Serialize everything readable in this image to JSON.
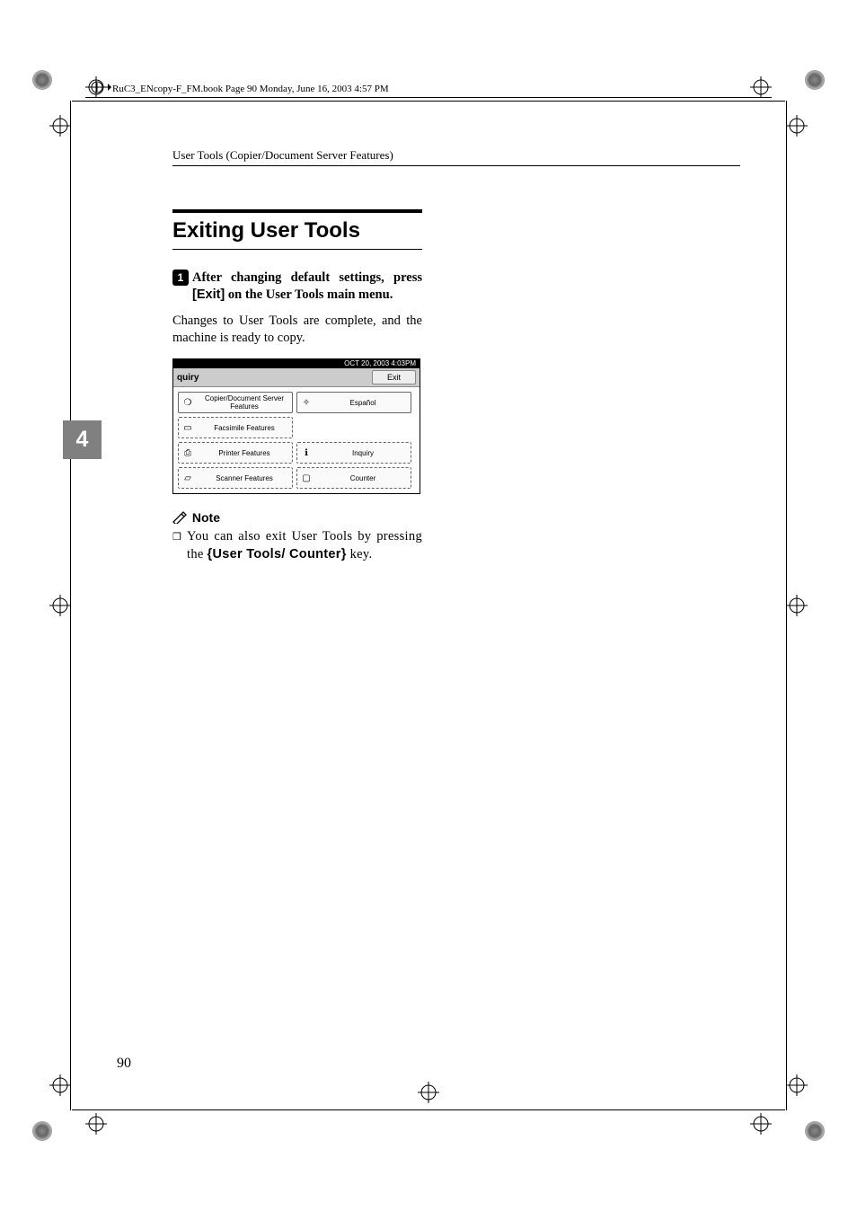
{
  "book_header": "RuC3_ENcopy-F_FM.book  Page 90  Monday, June 16, 2003  4:57 PM",
  "running_head": "User Tools (Copier/Document Server Features)",
  "section_title": "Exiting User Tools",
  "tab_number": "4",
  "step": {
    "num": "1",
    "line1": "After changing default settings,",
    "line2_pre": "press ",
    "exit_key": "[Exit]",
    "line2_post": " on the User Tools main",
    "line3": "menu."
  },
  "body": "Changes to User Tools are complete, and the machine is ready to copy.",
  "ui": {
    "status": "OCT    20, 2003    4:03PM",
    "top_label": "quiry",
    "exit": "Exit",
    "btns": {
      "copier": "Copier/Document Server Features",
      "espanol": "Español",
      "fax": "Facsimile Features",
      "printer": "Printer Features",
      "inquiry": "Inquiry",
      "scanner": "Scanner Features",
      "counter": "Counter"
    }
  },
  "note_label": "Note",
  "note": {
    "line1": "You can also exit User Tools",
    "line2_pre": "by pressing the ",
    "key_name": "User Tools/ Counter",
    "line2_post": " key."
  },
  "page_number": "90"
}
